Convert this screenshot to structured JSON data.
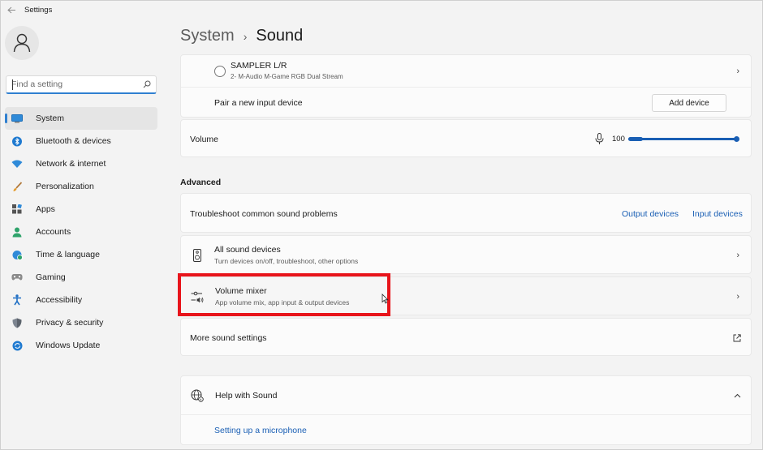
{
  "window": {
    "title": "Settings"
  },
  "sidebar": {
    "search_placeholder": "Find a setting",
    "items": [
      {
        "label": "System",
        "icon": "system-icon",
        "active": true
      },
      {
        "label": "Bluetooth & devices",
        "icon": "bluetooth-icon"
      },
      {
        "label": "Network & internet",
        "icon": "network-icon"
      },
      {
        "label": "Personalization",
        "icon": "brush-icon"
      },
      {
        "label": "Apps",
        "icon": "apps-icon"
      },
      {
        "label": "Accounts",
        "icon": "person-icon"
      },
      {
        "label": "Time & language",
        "icon": "globe-clock-icon"
      },
      {
        "label": "Gaming",
        "icon": "gamepad-icon"
      },
      {
        "label": "Accessibility",
        "icon": "accessibility-icon"
      },
      {
        "label": "Privacy & security",
        "icon": "shield-icon"
      },
      {
        "label": "Windows Update",
        "icon": "update-icon"
      }
    ]
  },
  "breadcrumb": {
    "parent": "System",
    "separator": "›",
    "current": "Sound"
  },
  "input_device": {
    "name": "SAMPLER L/R",
    "detail": "2- M-Audio M-Game RGB Dual Stream"
  },
  "pair_device": {
    "label": "Pair a new input device",
    "button": "Add device"
  },
  "volume": {
    "label": "Volume",
    "value": "100",
    "level": 1.0
  },
  "advanced": {
    "heading": "Advanced",
    "troubleshoot": {
      "label": "Troubleshoot common sound problems",
      "output_link": "Output devices",
      "input_link": "Input devices"
    },
    "all_devices": {
      "title": "All sound devices",
      "subtitle": "Turn devices on/off, troubleshoot, other options"
    },
    "mixer": {
      "title": "Volume mixer",
      "subtitle": "App volume mix, app input & output devices"
    },
    "more": {
      "label": "More sound settings"
    }
  },
  "help": {
    "title": "Help with Sound",
    "link": "Setting up a microphone"
  },
  "colors": {
    "accent": "#1a5fb4",
    "highlight": "#e8141b"
  }
}
